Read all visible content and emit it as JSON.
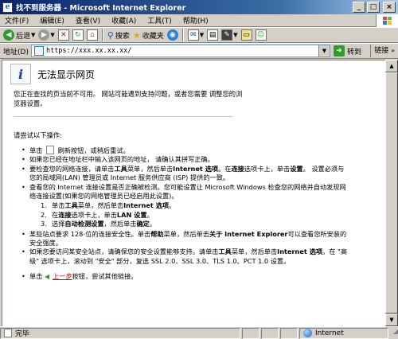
{
  "window": {
    "title": "找不到服务器 - Microsoft Internet Explorer",
    "app_icon": "ie-e-icon",
    "controls": {
      "minimize": "_",
      "maximize": "□",
      "close": "×"
    }
  },
  "menu": {
    "items": [
      "文件(F)",
      "编辑(E)",
      "查看(V)",
      "收藏(A)",
      "工具(T)",
      "帮助(H)"
    ]
  },
  "toolbar": {
    "back_label": "后退",
    "search_label": "搜索",
    "favorites_label": "收藏夹"
  },
  "address": {
    "label": "地址(D)",
    "url": "https://xxx.xx.xx.xx/",
    "go_label": "转到",
    "links_label": "链接"
  },
  "page": {
    "heading": "无法显示网页",
    "intro": "您正在查找的页当前不可用。 网站可能遇到支持问题，或者您需要 调整您的浏览器设置。",
    "try_following": "请尝试以下操作:",
    "items": {
      "i1_pre": "单击",
      "i1_post": "刷新按钮，或稍后重试。",
      "i2": "如果您已经在地址栏中输入该网页的地址， 请确认其拼写正确。",
      "i3_a": "要检查您的网络连接，请单击",
      "i3_b": "工具",
      "i3_c": "菜单，然后单击",
      "i3_d": "Internet 选项",
      "i3_e": "。在",
      "i3_f": "连接",
      "i3_g": "选项卡上，单击",
      "i3_h": "设置",
      "i3_i": "。 设置必须与您的局域网(LAN) 管理员或 Internet 服务供应商 (ISP) 提供的一致。",
      "i4": "查看您的 Internet 连接设置是否正确被检测。您可能设置让 Microsoft Windows 检查您的网络并自动发现网络连接设置(如果您的网络管理员已经启用此设置)。",
      "sub": [
        {
          "n": "1.",
          "a": "单击",
          "b": "工具",
          "c": "菜单，然后单击",
          "d": "Internet 选项",
          "e": "。"
        },
        {
          "n": "2.",
          "a": "在",
          "b": "连接",
          "c": "选项卡上，单击",
          "d": "LAN 设置",
          "e": "。"
        },
        {
          "n": "3.",
          "a": "选择",
          "b": "自动检测设置",
          "c": "，然后单击",
          "d": "确定",
          "e": "。"
        }
      ],
      "i5_a": "某些站点要求 128-位的连接安全性。单击",
      "i5_b": "帮助",
      "i5_c": "菜单，然后单击",
      "i5_d": "关于 Internet Explorer",
      "i5_e": "可以查看您所安装的安全强度。",
      "i6_a": "如果您要访问某安全站点，请确保您的安全设置能够支持。请单击",
      "i6_b": "工具",
      "i6_c": "菜单，然后单击",
      "i6_d": "Internet 选项",
      "i6_e": "。在 \"高级\" 选项卡上，滚动到 \"安全\" 部分，复选 SSL 2.0、SSL 3.0、TLS 1.0、PCT 1.0 设置。",
      "i7_pre": "单击",
      "i7_link": "上一步",
      "i7_post": "按钮，尝试其他链接。"
    }
  },
  "status": {
    "left": "完毕",
    "zone": "Internet"
  }
}
